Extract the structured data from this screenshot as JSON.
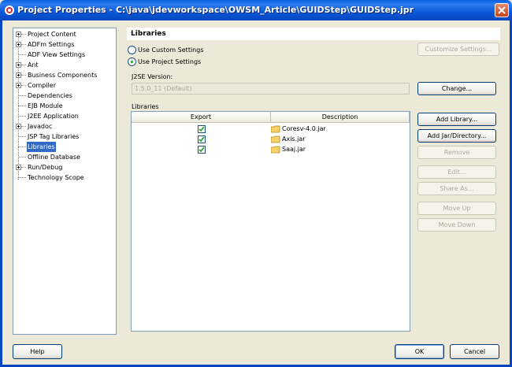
{
  "window": {
    "title": "Project Properties - C:\\java\\jdevworkspace\\OWSM_Article\\GUIDStep\\GUIDStep.jpr"
  },
  "tree": {
    "items": [
      {
        "label": "Project Content",
        "expandable": true
      },
      {
        "label": "ADFm Settings",
        "expandable": true
      },
      {
        "label": "ADF View Settings",
        "expandable": false
      },
      {
        "label": "Ant",
        "expandable": true
      },
      {
        "label": "Business Components",
        "expandable": true
      },
      {
        "label": "Compiler",
        "expandable": true
      },
      {
        "label": "Dependencies",
        "expandable": false
      },
      {
        "label": "EJB Module",
        "expandable": false
      },
      {
        "label": "J2EE Application",
        "expandable": false
      },
      {
        "label": "Javadoc",
        "expandable": true
      },
      {
        "label": "JSP Tag Libraries",
        "expandable": false
      },
      {
        "label": "Libraries",
        "expandable": false,
        "selected": true
      },
      {
        "label": "Offline Database",
        "expandable": false
      },
      {
        "label": "Run/Debug",
        "expandable": true
      },
      {
        "label": "Technology Scope",
        "expandable": false
      }
    ]
  },
  "panel": {
    "title": "Libraries",
    "use_custom": "Use Custom Settings",
    "use_project": "Use Project Settings",
    "customize_button": "Customize Settings...",
    "j2se_label": "J2SE Version:",
    "j2se_value": "1.5.0_11 (Default)",
    "change_button": "Change...",
    "libraries_label": "Libraries"
  },
  "table": {
    "columns": [
      "Export",
      "Description"
    ],
    "rows": [
      {
        "export": true,
        "description": "Coresv-4.0.jar"
      },
      {
        "export": true,
        "description": "Axis.jar"
      },
      {
        "export": true,
        "description": "Saaj.jar"
      }
    ]
  },
  "side_buttons": {
    "add_library": "Add Library...",
    "add_jar": "Add Jar/Directory...",
    "remove": "Remove",
    "edit": "Edit...",
    "share_as": "Share As...",
    "move_up": "Move Up",
    "move_down": "Move Down"
  },
  "footer": {
    "help": "Help",
    "ok": "OK",
    "cancel": "Cancel"
  }
}
